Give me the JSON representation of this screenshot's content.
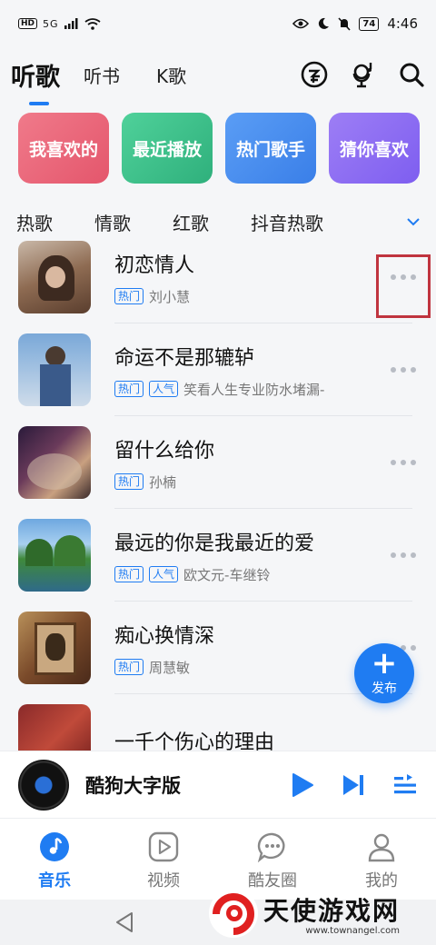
{
  "status": {
    "hd": "HD",
    "signal": "5G",
    "battery": "74",
    "time": "4:46"
  },
  "header": {
    "tabs": [
      "听歌",
      "听书",
      "K歌"
    ]
  },
  "cards": [
    {
      "label": "我喜欢的",
      "color": "#e8667a"
    },
    {
      "label": "最近播放",
      "color": "#3cbf8c"
    },
    {
      "label": "热门歌手",
      "color": "#4a8ef0"
    },
    {
      "label": "猜你喜欢",
      "color": "#8e6ef0"
    }
  ],
  "genres": [
    "热歌",
    "情歌",
    "红歌",
    "抖音热歌"
  ],
  "songs": [
    {
      "title": "初恋情人",
      "badges": [
        "热门"
      ],
      "artist": "刘小慧"
    },
    {
      "title": "命运不是那辘轳",
      "badges": [
        "热门",
        "人气"
      ],
      "artist": "笑看人生专业防水堵漏-"
    },
    {
      "title": "留什么给你",
      "badges": [
        "热门"
      ],
      "artist": "孙楠"
    },
    {
      "title": "最远的你是我最近的爱",
      "badges": [
        "热门",
        "人气"
      ],
      "artist": "欧文元-车继铃"
    },
    {
      "title": "痴心换情深",
      "badges": [
        "热门"
      ],
      "artist": "周慧敏"
    },
    {
      "title": "一千个伤心的理由",
      "badges": [],
      "artist": ""
    }
  ],
  "fab": {
    "label": "发布"
  },
  "player": {
    "title": "酷狗大字版"
  },
  "nav": [
    {
      "label": "音乐",
      "icon": "music-note-icon",
      "active": true
    },
    {
      "label": "视频",
      "icon": "video-icon",
      "active": false
    },
    {
      "label": "酷友圈",
      "icon": "chat-bubble-icon",
      "active": false
    },
    {
      "label": "我的",
      "icon": "person-icon",
      "active": false
    }
  ],
  "watermark": {
    "title": "天使游戏网",
    "url": "www.townangel.com"
  },
  "accent": "#1f7cf2",
  "highlight_color": "#c0343f"
}
